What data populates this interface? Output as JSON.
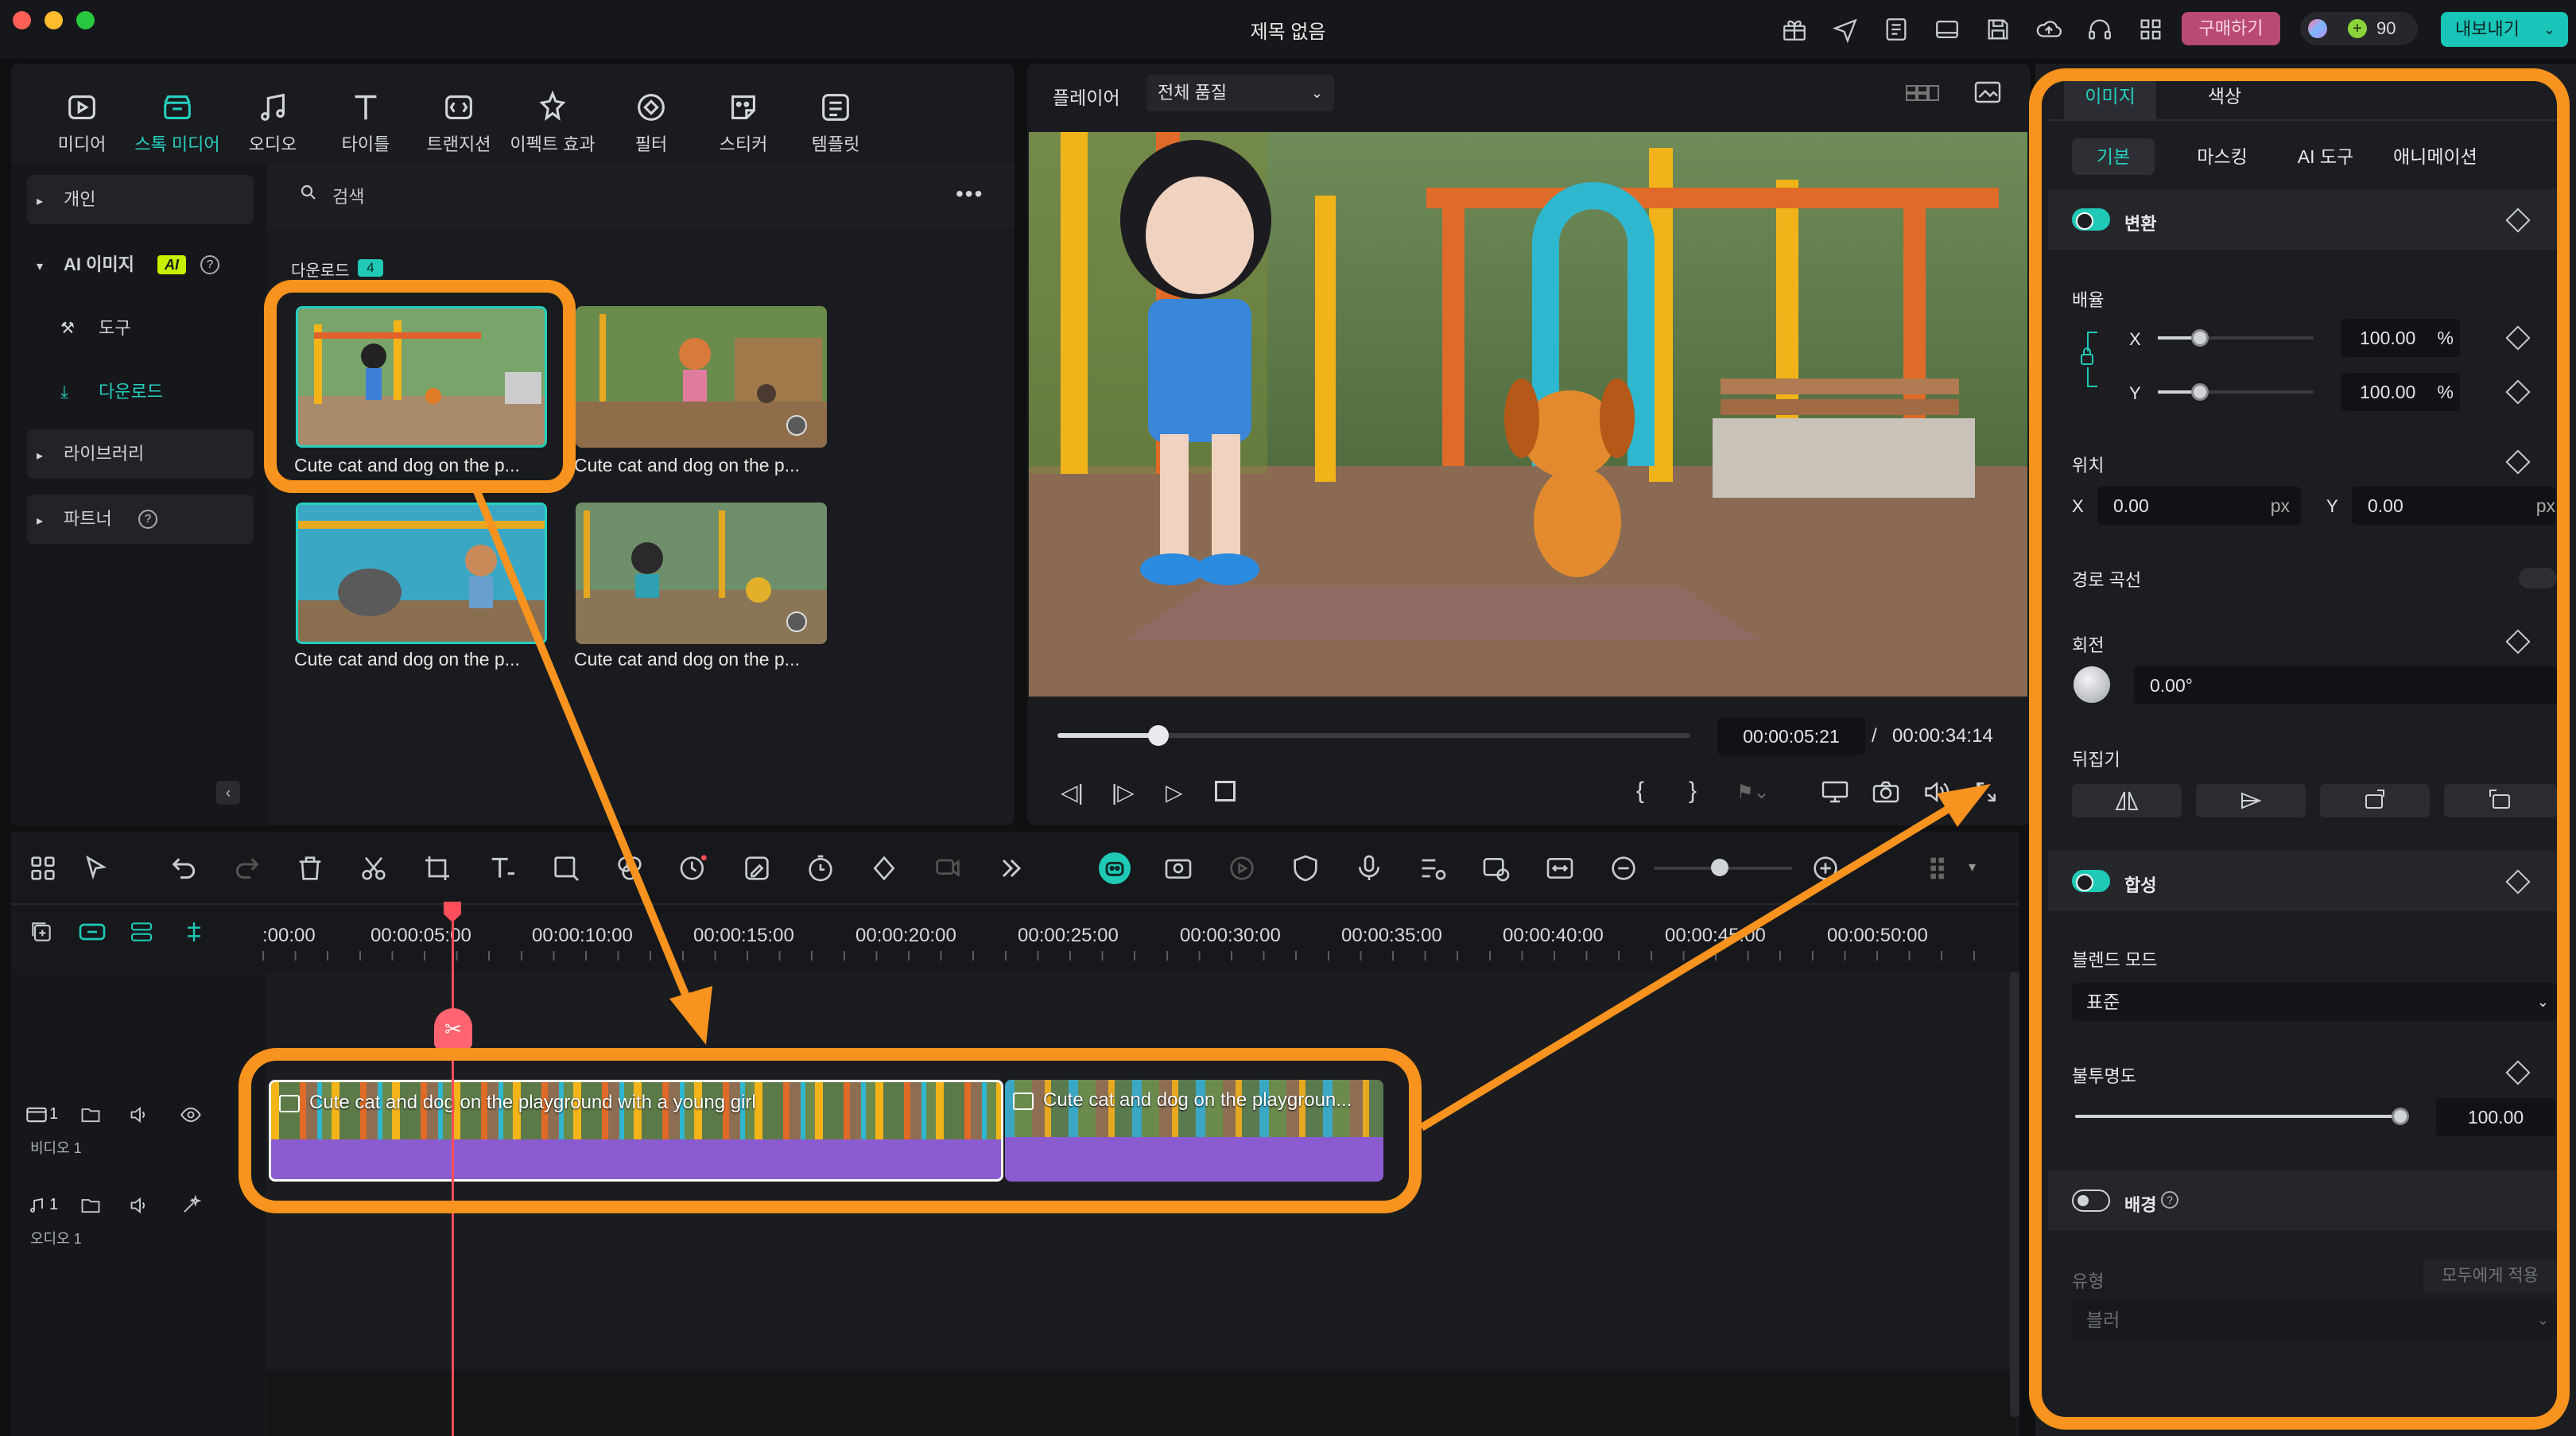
{
  "window": {
    "title": "제목 없음"
  },
  "titlebar": {
    "buy_label": "구매하기",
    "credits": "90",
    "export_label": "내보내기"
  },
  "media_toolbar": [
    {
      "label": "미디어",
      "icon": "media-icon"
    },
    {
      "label": "스톡 미디어",
      "icon": "stock-media-icon"
    },
    {
      "label": "오디오",
      "icon": "audio-icon"
    },
    {
      "label": "타이틀",
      "icon": "title-icon"
    },
    {
      "label": "트랜지션",
      "icon": "transition-icon"
    },
    {
      "label": "이펙트 효과",
      "icon": "effect-icon"
    },
    {
      "label": "필터",
      "icon": "filter-icon"
    },
    {
      "label": "스티커",
      "icon": "sticker-icon"
    },
    {
      "label": "템플릿",
      "icon": "template-icon"
    }
  ],
  "sidebar": {
    "personal": "개인",
    "ai_image": "AI 이미지",
    "ai_badge": "AI",
    "tools": "도구",
    "download": "다운로드",
    "library": "라이브러리",
    "partner": "파트너"
  },
  "media": {
    "search_placeholder": "검색",
    "section_label": "다운로드",
    "section_count": "4",
    "items": [
      {
        "caption": "Cute cat and dog on the p..."
      },
      {
        "caption": "Cute cat and dog on the p..."
      },
      {
        "caption": "Cute cat and dog on the p..."
      },
      {
        "caption": "Cute cat and dog on the p..."
      }
    ]
  },
  "player": {
    "label": "플레이어",
    "quality": "전체 품질",
    "current_time": "00:00:05:21",
    "separator": "/",
    "total_time": "00:00:34:14",
    "progress": 0.16
  },
  "timeline": {
    "ticks": [
      ":00:00",
      "00:00:05:00",
      "00:00:10:00",
      "00:00:15:00",
      "00:00:20:00",
      "00:00:25:00",
      "00:00:30:00",
      "00:00:35:00",
      "00:00:40:00",
      "00:00:45:00",
      "00:00:50:00"
    ],
    "video_track": {
      "number": "1",
      "label": "비디오 1"
    },
    "audio_track": {
      "number": "1",
      "label": "오디오 1"
    },
    "clips": [
      {
        "title": "Cute cat and dog on the playground with a young girl"
      },
      {
        "title": "Cute cat and dog on the playgroun..."
      }
    ]
  },
  "inspector": {
    "tabs": [
      "이미지",
      "색상"
    ],
    "subtabs": [
      "기본",
      "마스킹",
      "AI 도구",
      "애니메이션"
    ],
    "transform": {
      "label": "변환"
    },
    "scale": {
      "label": "배율",
      "x_label": "X",
      "x_value": "100.00",
      "y_label": "Y",
      "y_value": "100.00",
      "unit": "%"
    },
    "position": {
      "label": "위치",
      "x_label": "X",
      "x_value": "0.00",
      "y_label": "Y",
      "y_value": "0.00",
      "unit": "px"
    },
    "path_curve": {
      "label": "경로 곡선"
    },
    "rotation": {
      "label": "회전",
      "value": "0.00°"
    },
    "flip": {
      "label": "뒤집기"
    },
    "composite": {
      "label": "합성"
    },
    "blend_mode": {
      "label": "블렌드 모드",
      "value": "표준"
    },
    "opacity": {
      "label": "불투명도",
      "value": "100.00"
    },
    "background": {
      "label": "배경"
    },
    "type": {
      "label": "유형",
      "apply_all": "모두에게 적용",
      "value": "블러"
    }
  },
  "colors": {
    "accent": "#1fc9b6",
    "callout": "#f7931e",
    "clip": "#8a5cd0",
    "playhead": "#ff4d5a"
  }
}
